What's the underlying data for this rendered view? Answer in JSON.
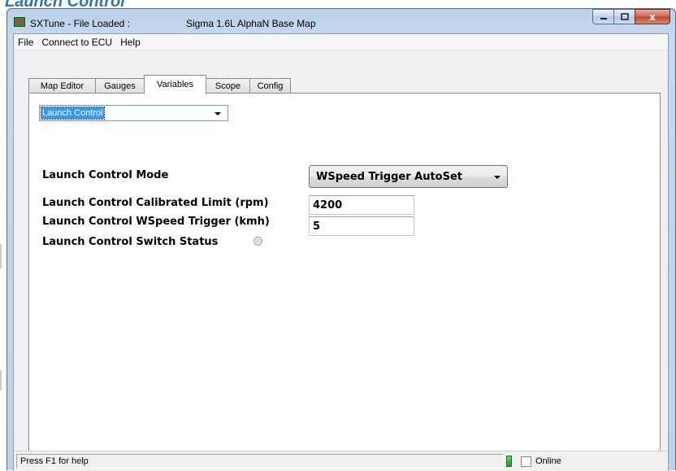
{
  "background": {
    "heading_partial": "Launch Control"
  },
  "window": {
    "title_prefix": "SXTune - File Loaded :",
    "title_map": "Sigma 1.6L AlphaN Base Map",
    "buttons": {
      "min_icon": "minimize-icon",
      "max_icon": "maximize-icon",
      "close_glyph": "x"
    }
  },
  "menu": [
    "File",
    "Connect to ECU",
    "Help"
  ],
  "tabs": [
    "Map Editor",
    "Gauges",
    "Variables",
    "Scope",
    "Config"
  ],
  "active_tab": "Variables",
  "panel": {
    "category_select": "Launch Control",
    "mode_label": "Launch Control Mode",
    "mode_value": "WSpeed Trigger AutoSet",
    "limit_label": "Launch Control Calibrated Limit (rpm)",
    "limit_value": "4200",
    "trigger_label": "Launch Control WSpeed Trigger (kmh)",
    "trigger_value": "5",
    "switch_label": "Launch Control Switch Status"
  },
  "status": {
    "help_text": "Press F1 for help",
    "led_color": "#2fb52f",
    "online_label": "Online",
    "online_checked": false
  }
}
